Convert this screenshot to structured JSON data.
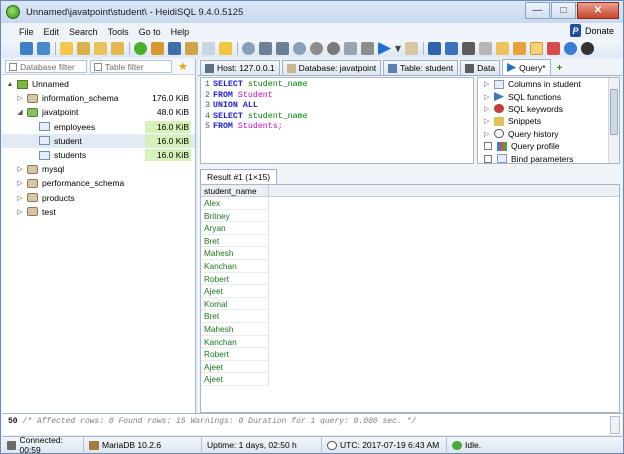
{
  "window": {
    "title": "Unnamed\\javatpoint\\student\\ - HeidiSQL 9.4.0.5125",
    "min": "—",
    "max": "□",
    "close": "✕"
  },
  "menu": {
    "items": [
      "File",
      "Edit",
      "Search",
      "Tools",
      "Go to",
      "Help"
    ],
    "donate": "Donate"
  },
  "left": {
    "db_filter_placeholder": "Database filter",
    "table_filter_placeholder": "Table filter",
    "tree": [
      {
        "label": "Unnamed",
        "size": "",
        "level": 0,
        "expander": "▲"
      },
      {
        "label": "information_schema",
        "size": "176.0 KiB",
        "level": 1,
        "expander": "▷"
      },
      {
        "label": "javatpoint",
        "size": "48.0 KiB",
        "level": 1,
        "expander": "◢"
      },
      {
        "label": "employees",
        "size": "16.0 KiB",
        "level": 2,
        "expander": ""
      },
      {
        "label": "student",
        "size": "16.0 KiB",
        "level": 2,
        "expander": ""
      },
      {
        "label": "students",
        "size": "16.0 KiB",
        "level": 2,
        "expander": ""
      },
      {
        "label": "mysql",
        "size": "",
        "level": 1,
        "expander": "▷"
      },
      {
        "label": "performance_schema",
        "size": "",
        "level": 1,
        "expander": "▷"
      },
      {
        "label": "products",
        "size": "",
        "level": 1,
        "expander": "▷"
      },
      {
        "label": "test",
        "size": "",
        "level": 1,
        "expander": "▷"
      }
    ]
  },
  "tabs": [
    {
      "label": "Host: 127.0.0.1"
    },
    {
      "label": "Database: javatpoint"
    },
    {
      "label": "Table: student"
    },
    {
      "label": "Data"
    },
    {
      "label": "Query*"
    }
  ],
  "editor": {
    "lines": [
      {
        "n": "1",
        "kw": "SELECT",
        "rest": " student_name",
        "rest_class": "id"
      },
      {
        "n": "2",
        "kw": "FROM",
        "rest": " Student",
        "rest_class": "tblname"
      },
      {
        "n": "3",
        "kw": "UNION ALL",
        "rest": "",
        "rest_class": "id"
      },
      {
        "n": "4",
        "kw": "SELECT",
        "rest": " student_name",
        "rest_class": "id"
      },
      {
        "n": "5",
        "kw": "FROM",
        "rest": " Students;",
        "rest_class": "tblname"
      }
    ]
  },
  "helpers": [
    {
      "label": "Columns in student"
    },
    {
      "label": "SQL functions"
    },
    {
      "label": "SQL keywords"
    },
    {
      "label": "Snippets"
    },
    {
      "label": "Query history"
    },
    {
      "label": "Query profile"
    },
    {
      "label": "Bind parameters"
    }
  ],
  "result": {
    "tab_label": "Result #1 (1×15)",
    "column": "student_name",
    "rows": [
      "Alex",
      "Britney",
      "Aryan",
      "Bret",
      "Mahesh",
      "Kanchan",
      "Robert",
      "Ajeet",
      "Komal",
      "Bret",
      "Mahesh",
      "Kanchan",
      "Robert",
      "Ajeet",
      "Ajeet"
    ]
  },
  "log": {
    "num": "50",
    "text": "/* Affected rows: 0  Found rows: 15  Warnings: 0  Duration for 1 query: 0.000 sec. */"
  },
  "status": {
    "connected": "Connected: 00:59",
    "server": "MariaDB 10.2.6",
    "uptime": "Uptime: 1 days, 02:50 h",
    "utc": "UTC: 2017-07-19 6:43 AM",
    "state": "Idle."
  }
}
